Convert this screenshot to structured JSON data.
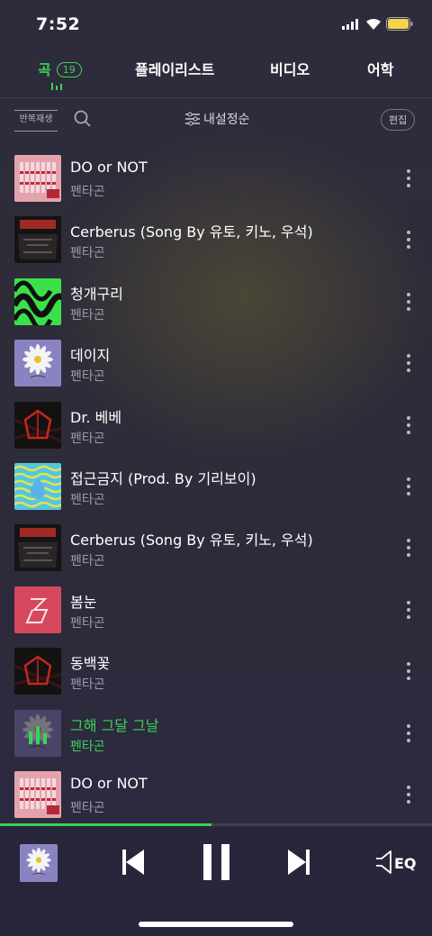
{
  "status": {
    "time": "7:52"
  },
  "tabs": [
    {
      "label": "곡",
      "count": "19"
    },
    {
      "label": "플레이리스트"
    },
    {
      "label": "비디오"
    },
    {
      "label": "어학"
    }
  ],
  "toolbar": {
    "repeat_label": "반복재생",
    "sort_label": "내설정순",
    "edit_label": "편집"
  },
  "songs": [
    {
      "title": "DO or NOT",
      "artist": "펜타곤",
      "art": "pink-strips"
    },
    {
      "title": "Cerberus (Song By 유토, 키노, 우석)",
      "artist": "펜타곤",
      "art": "dark-red"
    },
    {
      "title": "청개구리",
      "artist": "펜타곤",
      "art": "green-wave"
    },
    {
      "title": "데이지",
      "artist": "펜타곤",
      "art": "daisy"
    },
    {
      "title": "Dr. 베베",
      "artist": "펜타곤",
      "art": "red-logo"
    },
    {
      "title": "접근금지 (Prod. By 기리보이)",
      "artist": "펜타곤",
      "art": "cyan-wave"
    },
    {
      "title": "Cerberus (Song By 유토, 키노, 우석)",
      "artist": "펜타곤",
      "art": "dark-red"
    },
    {
      "title": "봄눈",
      "artist": "펜타곤",
      "art": "pink-logo"
    },
    {
      "title": "동백꽃",
      "artist": "펜타곤",
      "art": "red-logo"
    },
    {
      "title": "그해 그달 그날",
      "artist": "펜타곤",
      "art": "daisy-playing",
      "playing": true
    },
    {
      "title": "DO or NOT",
      "artist": "펜타곤",
      "art": "pink-strips"
    }
  ],
  "player": {
    "progress": 0.49,
    "eq_label": "EQ",
    "now_art": "daisy"
  },
  "colors": {
    "accent": "#3ad35a",
    "bg": "#2e2b3d"
  }
}
